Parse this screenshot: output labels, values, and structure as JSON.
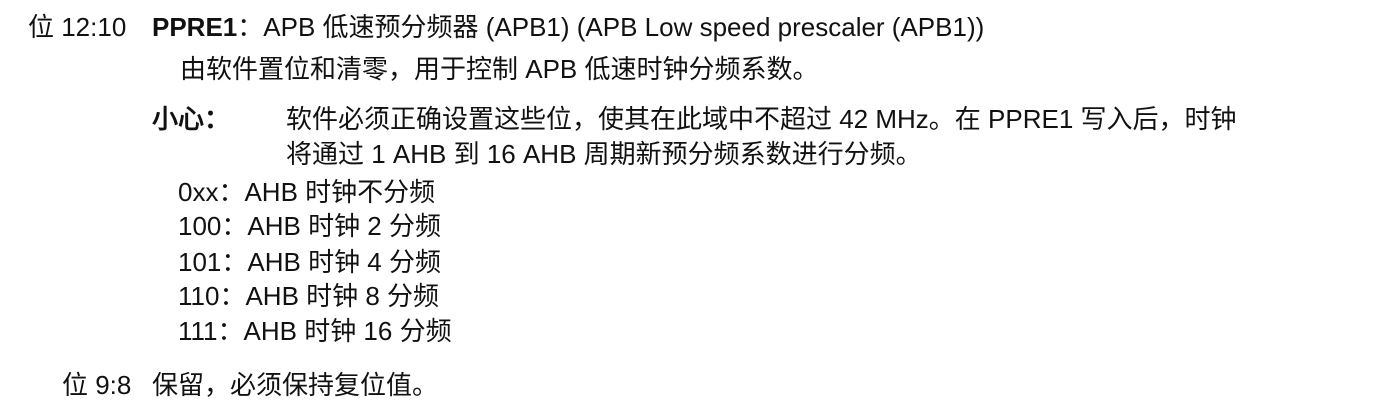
{
  "bits_12_10": {
    "label": "位 12:10",
    "field_name": "PPRE1",
    "title_rest": "：APB 低速预分频器 (APB1) (APB Low speed prescaler (APB1))",
    "description": "由软件置位和清零，用于控制 APB 低速时钟分频系数。",
    "caution_label": "小心：",
    "caution_line1": "软件必须正确设置这些位，使其在此域中不超过 42 MHz。在 PPRE1 写入后，时钟",
    "caution_line2": "将通过 1 AHB 到 16 AHB 周期新预分频系数进行分频。",
    "options": [
      "0xx：AHB 时钟不分频",
      "100：AHB 时钟 2 分频",
      "101：AHB 时钟 4 分频",
      "110：AHB 时钟 8 分频",
      "111：AHB 时钟 16 分频"
    ]
  },
  "bits_9_8": {
    "label": "位 9:8",
    "description": "保留，必须保持复位值。"
  }
}
